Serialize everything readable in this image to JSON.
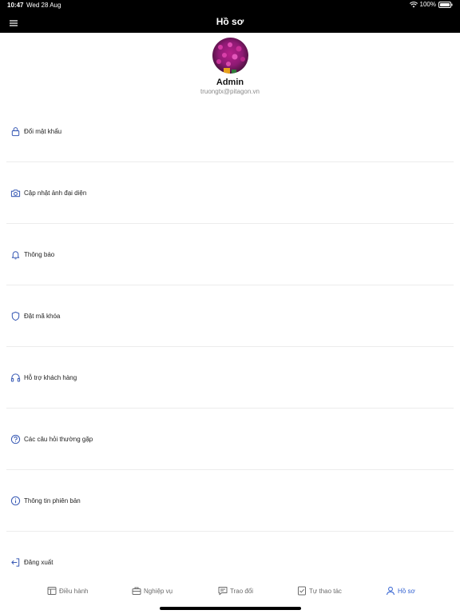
{
  "status_bar": {
    "time": "10:47",
    "date": "Wed 28 Aug",
    "battery": "100%"
  },
  "nav": {
    "title": "Hồ sơ",
    "menu_icon": "hamburger-icon"
  },
  "profile": {
    "name": "Admin",
    "email": "truongtx@pitagon.vn"
  },
  "menu": [
    {
      "label": "Đổi mật khẩu",
      "icon": "lock-icon"
    },
    {
      "label": "Cập nhật ảnh đại diện",
      "icon": "camera-icon"
    },
    {
      "label": "Thông báo",
      "icon": "bell-icon"
    },
    {
      "label": "Đặt mã khóa",
      "icon": "shield-icon"
    },
    {
      "label": "Hỗ trợ khách hàng",
      "icon": "headset-icon"
    },
    {
      "label": "Các câu hỏi thường gặp",
      "icon": "question-icon"
    },
    {
      "label": "Thông tin phiên bản",
      "icon": "info-icon"
    },
    {
      "label": "Đăng xuất",
      "icon": "logout-icon"
    }
  ],
  "tabs": [
    {
      "label": "Điều hành",
      "icon": "layout-icon",
      "active": false
    },
    {
      "label": "Nghiệp vụ",
      "icon": "briefcase-icon",
      "active": false
    },
    {
      "label": "Trao đổi",
      "icon": "chat-icon",
      "active": false
    },
    {
      "label": "Tự thao tác",
      "icon": "checklist-icon",
      "active": false
    },
    {
      "label": "Hồ sơ",
      "icon": "user-icon",
      "active": true
    }
  ],
  "colors": {
    "accent": "#2f5fd0",
    "icon": "#3a5bb5",
    "top_bar": "#000000"
  }
}
